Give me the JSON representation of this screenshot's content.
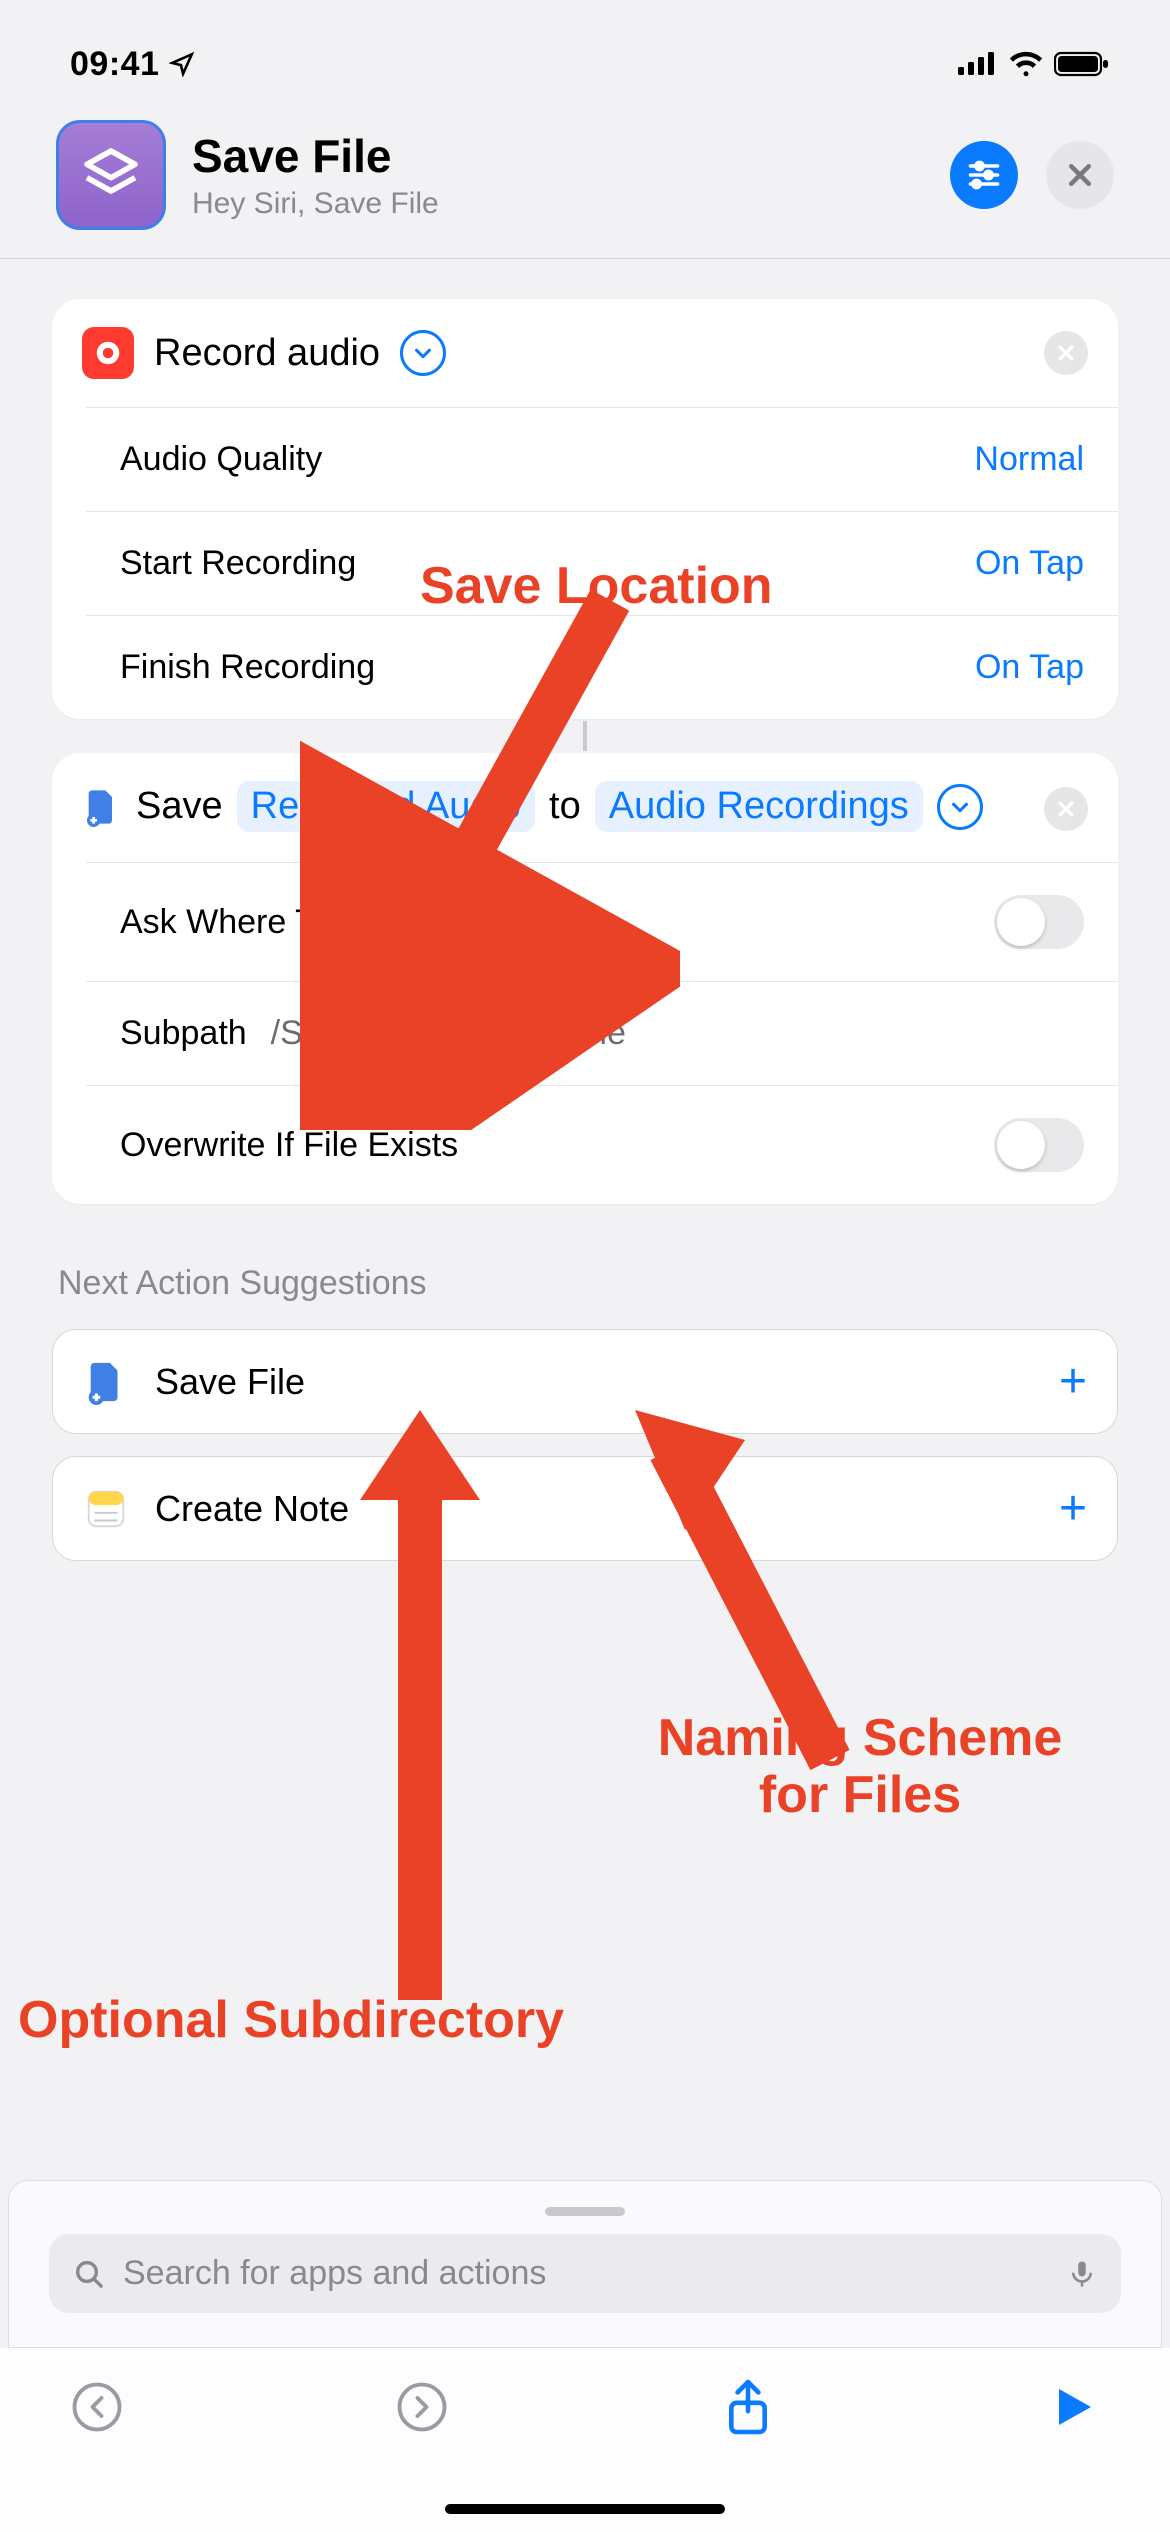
{
  "status": {
    "time": "09:41"
  },
  "header": {
    "title": "Save File",
    "subtitle": "Hey Siri, Save File"
  },
  "record_action": {
    "title": "Record audio",
    "rows": {
      "quality_label": "Audio Quality",
      "quality_value": "Normal",
      "start_label": "Start Recording",
      "start_value": "On Tap",
      "finish_label": "Finish Recording",
      "finish_value": "On Tap"
    }
  },
  "save_action": {
    "word_save": "Save",
    "pill_input": "Recorded Audio",
    "word_to": "to",
    "pill_dest": "Audio Recordings",
    "ask_label": "Ask Where To Save",
    "subpath_label": "Subpath",
    "subpath_value": "/Subdirectory/FileName",
    "overwrite_label": "Overwrite If File Exists"
  },
  "suggestions": {
    "title": "Next Action Suggestions",
    "items": [
      {
        "label": "Save File"
      },
      {
        "label": "Create Note"
      }
    ]
  },
  "search": {
    "placeholder": "Search for apps and actions"
  },
  "annotations": {
    "save_location": "Save Location",
    "optional_subdir": "Optional Subdirectory",
    "naming_scheme": "Naming Scheme\nfor Files"
  }
}
